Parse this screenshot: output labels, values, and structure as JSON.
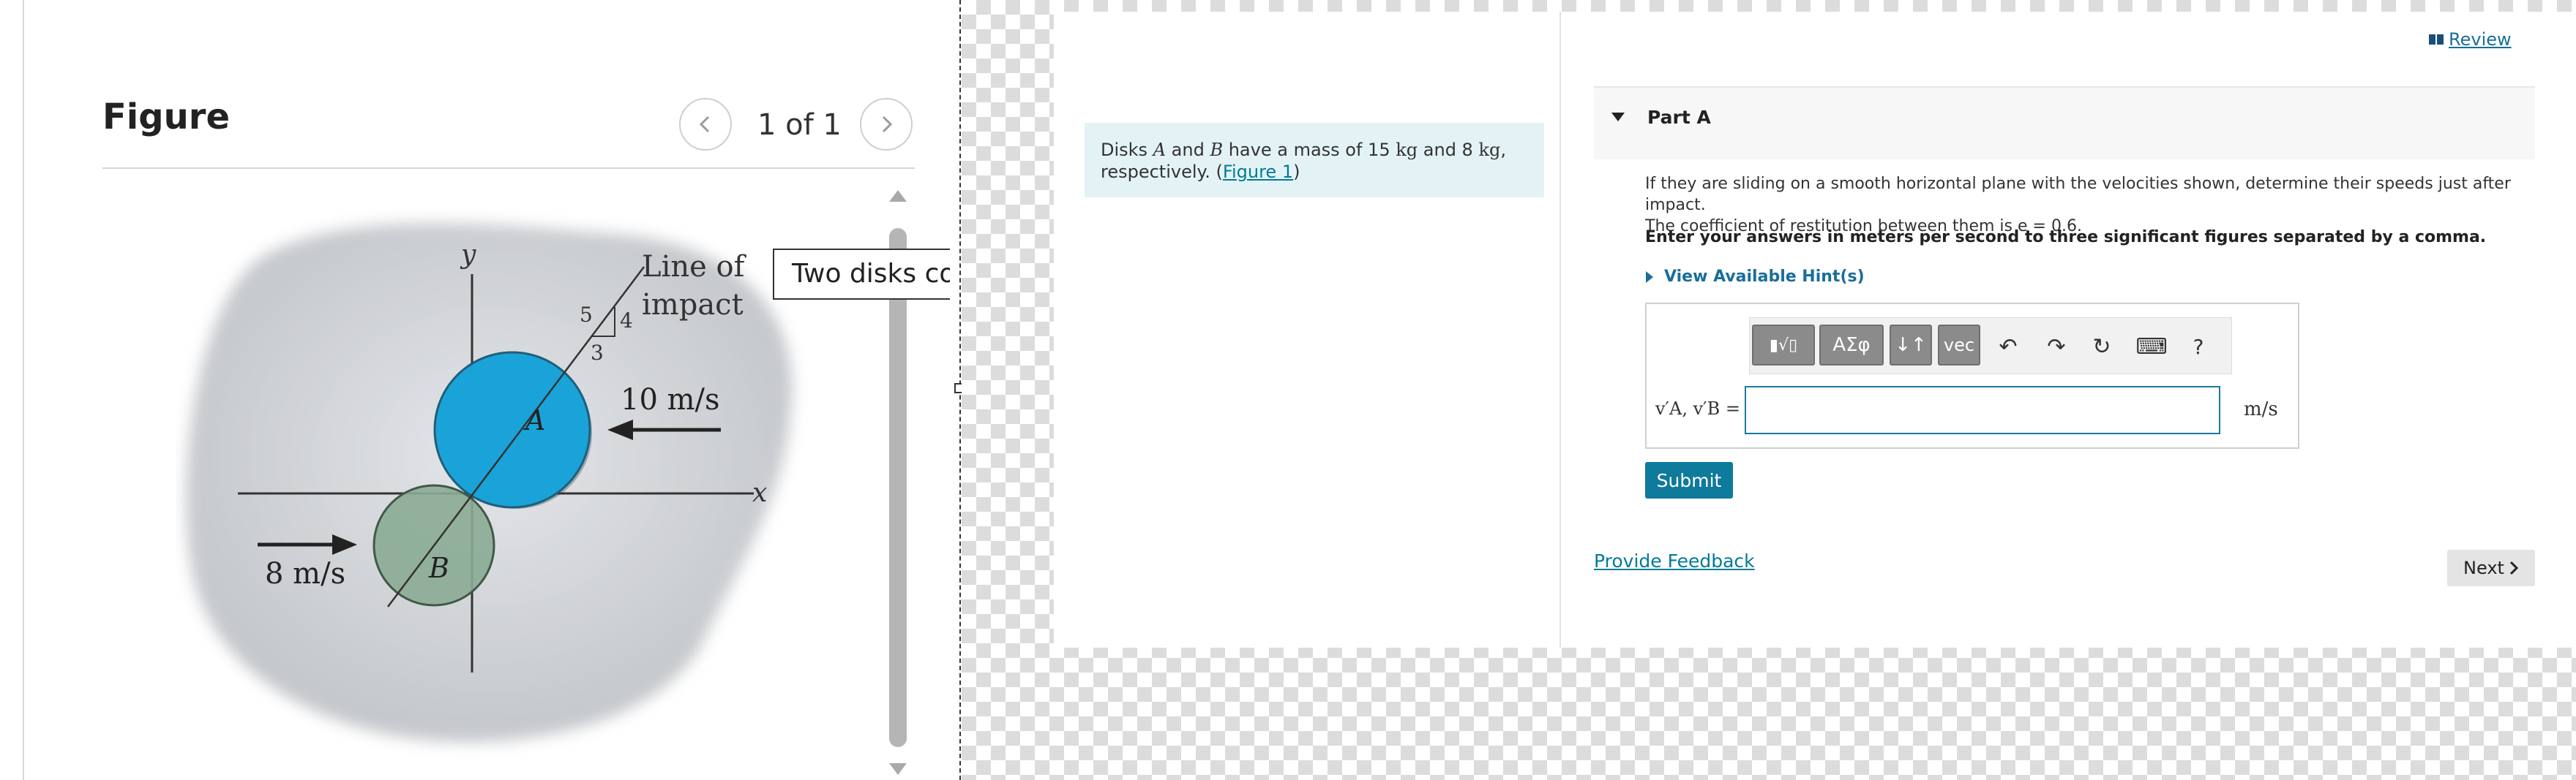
{
  "figure_panel": {
    "title": "Figure",
    "page_count": "1 of 1",
    "tooltip": "Two disks colli",
    "figure": {
      "axis_y": "y",
      "axis_x": "x",
      "line_label_1": "Line of",
      "line_label_2": "impact",
      "slope_5": "5",
      "slope_4": "4",
      "slope_3": "3",
      "disk_a": "A",
      "disk_b": "B",
      "speed_a": "10 m/s",
      "speed_b": "8 m/s",
      "disk_a_color": "#1aa3d8",
      "disk_b_color": "#8aab94"
    }
  },
  "intro": {
    "t1": "Disks ",
    "a": "A",
    "t2": " and ",
    "b": "B",
    "t3": " have a mass of 15 ",
    "kg1": "kg",
    "t4": " and 8 ",
    "kg2": "kg",
    "t5": ",",
    "t6": "respectively. (",
    "figure_link": "Figure 1",
    "t7": ")"
  },
  "review_link": "Review",
  "part_a": {
    "title": "Part A",
    "question_1": "If they are sliding on a smooth horizontal plane with the velocities shown, determine their speeds just after impact.",
    "question_2": "The coefficient of restitution between them is e = 0.6.",
    "instruction": "Enter your answers in meters per second to three significant figures separated by a comma.",
    "hints": "View Available Hint(s)"
  },
  "toolbar": {
    "templates": "▮√▯",
    "symbols": "ΑΣφ",
    "arrows": "↓↑",
    "vec": "vec",
    "undo": "↶",
    "redo": "↷",
    "reset": "↻",
    "keyboard": "⌨",
    "help": "?"
  },
  "answer": {
    "label": "v′A, v′B =",
    "value": "",
    "unit": "m/s"
  },
  "submit": "Submit",
  "feedback": "Provide Feedback",
  "next": "Next"
}
